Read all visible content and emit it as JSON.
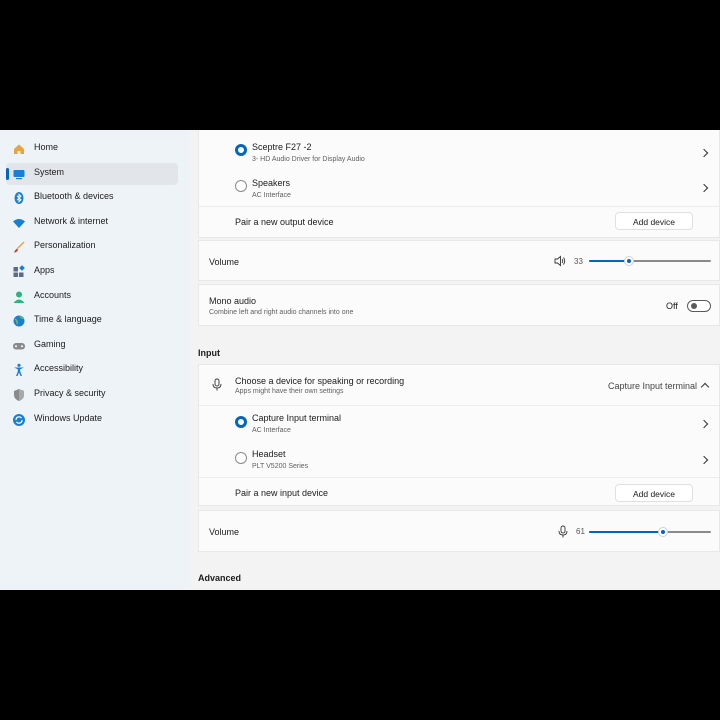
{
  "sidebar": {
    "items": [
      {
        "label": "Home",
        "icon": "home-icon",
        "color": "#e8a33c"
      },
      {
        "label": "System",
        "icon": "monitor-icon",
        "color": "#1a7fd1",
        "selected": true
      },
      {
        "label": "Bluetooth & devices",
        "icon": "bluetooth-icon",
        "color": "#1a7fd1"
      },
      {
        "label": "Network & internet",
        "icon": "wifi-icon",
        "color": "#1a7fd1"
      },
      {
        "label": "Personalization",
        "icon": "brush-icon",
        "color": "#e8a33c"
      },
      {
        "label": "Apps",
        "icon": "apps-icon",
        "color": "#5a6c86"
      },
      {
        "label": "Accounts",
        "icon": "person-icon",
        "color": "#2db37e"
      },
      {
        "label": "Time & language",
        "icon": "globe-icon",
        "color": "#1a7fd1"
      },
      {
        "label": "Gaming",
        "icon": "gamepad-icon",
        "color": "#7a7a7a"
      },
      {
        "label": "Accessibility",
        "icon": "accessibility-icon",
        "color": "#1a7fd1"
      },
      {
        "label": "Privacy & security",
        "icon": "shield-icon",
        "color": "#7a7a7a"
      },
      {
        "label": "Windows Update",
        "icon": "update-icon",
        "color": "#1a7fd1"
      }
    ]
  },
  "output": {
    "devices": [
      {
        "name": "Sceptre F27 -2",
        "sub": "3- HD Audio Driver for Display Audio",
        "selected": true
      },
      {
        "name": "Speakers",
        "sub": "AC Interface",
        "selected": false
      }
    ],
    "pair_label": "Pair a new output device",
    "add_button": "Add device",
    "volume_label": "Volume",
    "volume_value": "33",
    "volume_level": 33,
    "mono_title": "Mono audio",
    "mono_sub": "Combine left and right audio channels into one",
    "mono_state": "Off"
  },
  "input": {
    "section_title": "Input",
    "choose_title": "Choose a device for speaking or recording",
    "choose_sub": "Apps might have their own settings",
    "choose_value": "Capture Input terminal",
    "devices": [
      {
        "name": "Capture Input terminal",
        "sub": "AC Interface",
        "selected": true
      },
      {
        "name": "Headset",
        "sub": "PLT V5200 Series",
        "selected": false
      }
    ],
    "pair_label": "Pair a new input device",
    "add_button": "Add device",
    "volume_label": "Volume",
    "volume_value": "61",
    "volume_level": 61
  },
  "advanced": {
    "section_title": "Advanced"
  },
  "colors": {
    "accent": "#0067c0"
  }
}
